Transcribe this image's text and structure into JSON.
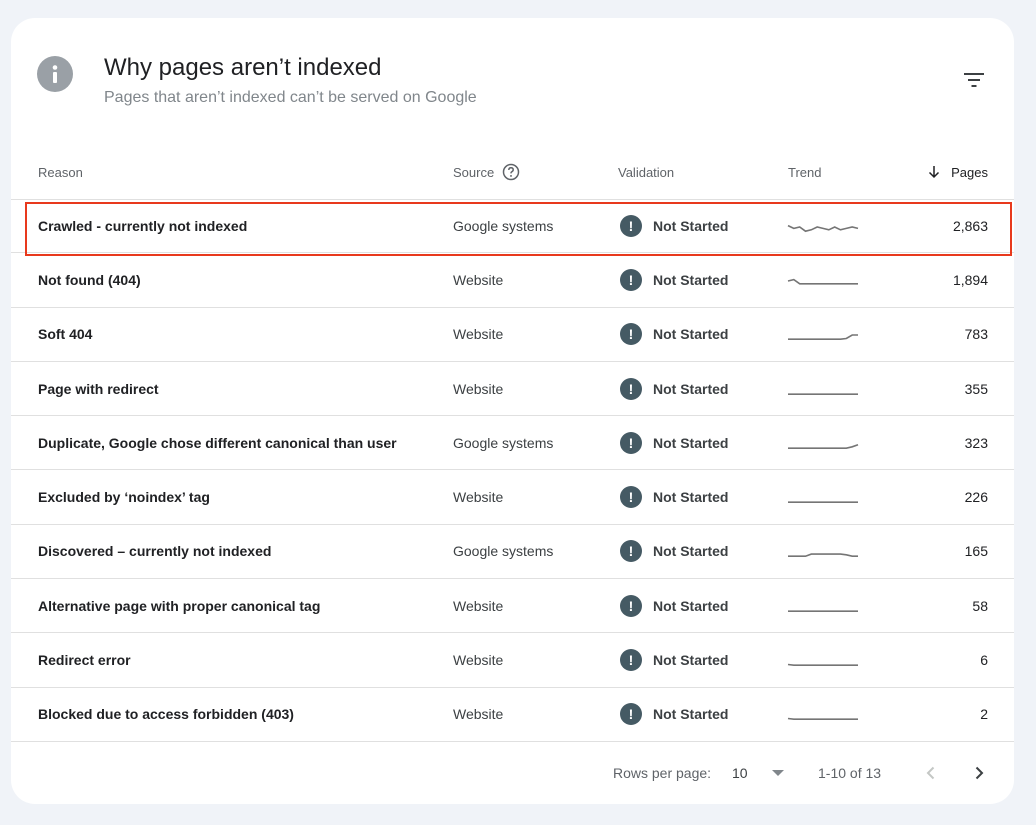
{
  "header": {
    "title": "Why pages aren’t indexed",
    "subtitle": "Pages that aren’t indexed can’t be served on Google",
    "info_icon_label": "i"
  },
  "columns": {
    "reason": "Reason",
    "source": "Source",
    "validation": "Validation",
    "trend": "Trend",
    "pages": "Pages"
  },
  "rows": [
    {
      "reason": "Crawled - currently not indexed",
      "source": "Google systems",
      "validation": "Not Started",
      "pages": "2,863",
      "trend": [
        0.6,
        0.4,
        0.5,
        0.2,
        0.3,
        0.5,
        0.4,
        0.3,
        0.5,
        0.3,
        0.4,
        0.5,
        0.4
      ]
    },
    {
      "reason": "Not found (404)",
      "source": "Website",
      "validation": "Not Started",
      "pages": "1,894",
      "trend": [
        0.5,
        0.6,
        0.3,
        0.3,
        0.3,
        0.3,
        0.3,
        0.3,
        0.3,
        0.3,
        0.3,
        0.3,
        0.3
      ]
    },
    {
      "reason": "Soft 404",
      "source": "Website",
      "validation": "Not Started",
      "pages": "783",
      "trend": [
        0.2,
        0.2,
        0.2,
        0.2,
        0.2,
        0.2,
        0.2,
        0.2,
        0.2,
        0.2,
        0.25,
        0.5,
        0.5
      ]
    },
    {
      "reason": "Page with redirect",
      "source": "Website",
      "validation": "Not Started",
      "pages": "355",
      "trend": [
        0.2,
        0.2,
        0.2,
        0.2,
        0.2,
        0.2,
        0.2,
        0.2,
        0.2,
        0.2,
        0.2,
        0.2,
        0.2
      ]
    },
    {
      "reason": "Duplicate, Google chose different canonical than user",
      "source": "Google systems",
      "validation": "Not Started",
      "pages": "323",
      "trend": [
        0.2,
        0.2,
        0.2,
        0.2,
        0.2,
        0.2,
        0.2,
        0.2,
        0.2,
        0.2,
        0.2,
        0.3,
        0.45
      ]
    },
    {
      "reason": "Excluded by ‘noindex’ tag",
      "source": "Website",
      "validation": "Not Started",
      "pages": "226",
      "trend": [
        0.2,
        0.2,
        0.2,
        0.2,
        0.2,
        0.2,
        0.2,
        0.2,
        0.2,
        0.2,
        0.2,
        0.2,
        0.2
      ]
    },
    {
      "reason": "Discovered – currently not indexed",
      "source": "Google systems",
      "validation": "Not Started",
      "pages": "165",
      "trend": [
        0.2,
        0.2,
        0.2,
        0.2,
        0.35,
        0.35,
        0.35,
        0.35,
        0.35,
        0.35,
        0.3,
        0.2,
        0.2
      ]
    },
    {
      "reason": "Alternative page with proper canonical tag",
      "source": "Website",
      "validation": "Not Started",
      "pages": "58",
      "trend": [
        0.2,
        0.2,
        0.2,
        0.2,
        0.2,
        0.2,
        0.2,
        0.2,
        0.2,
        0.2,
        0.2,
        0.2,
        0.2
      ]
    },
    {
      "reason": "Redirect error",
      "source": "Website",
      "validation": "Not Started",
      "pages": "6",
      "trend": [
        0.25,
        0.2,
        0.2,
        0.2,
        0.2,
        0.2,
        0.2,
        0.2,
        0.2,
        0.2,
        0.2,
        0.2,
        0.2
      ]
    },
    {
      "reason": "Blocked due to access forbidden (403)",
      "source": "Website",
      "validation": "Not Started",
      "pages": "2",
      "trend": [
        0.25,
        0.2,
        0.2,
        0.2,
        0.2,
        0.2,
        0.2,
        0.2,
        0.2,
        0.2,
        0.2,
        0.2,
        0.2
      ]
    }
  ],
  "footer": {
    "rows_per_page_label": "Rows per page:",
    "rows_per_page_value": "10",
    "range_label": "1-10 of 13"
  },
  "colors": {
    "highlight_border": "#e8391d",
    "warning_icon": "#455a64",
    "trend_line": "#757575"
  }
}
